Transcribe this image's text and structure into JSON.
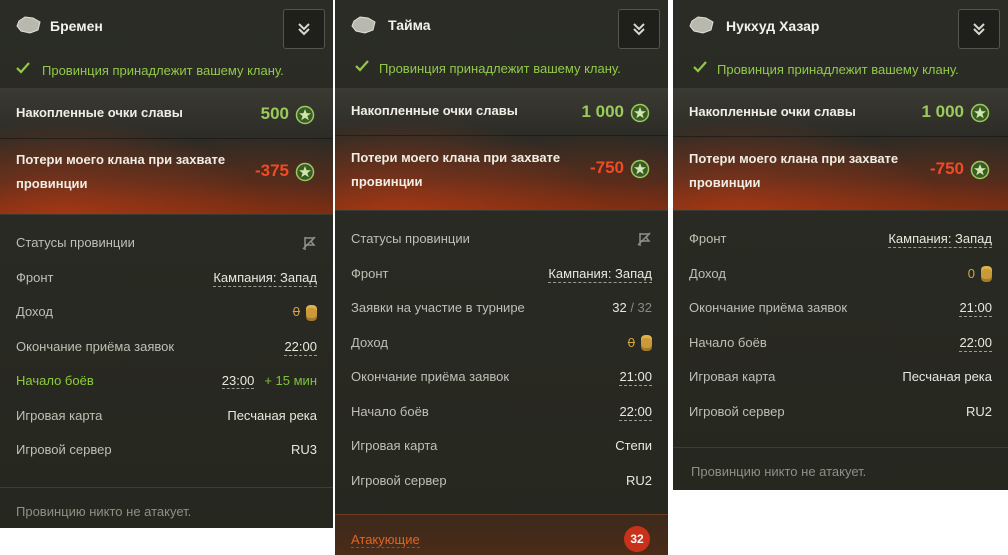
{
  "panels": [
    {
      "title": "Бремен",
      "owned": "Провинция принадлежит вашему клану.",
      "fame_label": "Накопленные очки славы",
      "fame_value": "500",
      "loss_label": "Потери моего клана при захвате провинции",
      "loss_value": "-375",
      "rows": {
        "status": "Статусы провинции",
        "front_k": "Фронт",
        "front_v": "Кампания: Запад",
        "income_k": "Доход",
        "income_v": "0",
        "end_k": "Окончание приёма заявок",
        "end_v": "22:00",
        "start_k": "Начало боёв",
        "start_v": "23:00",
        "start_plus": "+ 15 мин",
        "map_k": "Игровая карта",
        "map_v": "Песчаная река",
        "server_k": "Игровой сервер",
        "server_v": "RU3"
      },
      "footer": "Провинцию никто не атакует."
    },
    {
      "title": "Тайма",
      "owned": "Провинция принадлежит вашему клану.",
      "fame_label": "Накопленные очки славы",
      "fame_value": "1 000",
      "loss_label": "Потери моего клана при захвате провинции",
      "loss_value": "-750",
      "rows": {
        "status": "Статусы провинции",
        "front_k": "Фронт",
        "front_v": "Кампания: Запад",
        "apps_k": "Заявки на участие в турнире",
        "apps_v": "32",
        "apps_total": "/ 32",
        "income_k": "Доход",
        "income_v": "0",
        "end_k": "Окончание приёма заявок",
        "end_v": "21:00",
        "start_k": "Начало боёв",
        "start_v": "22:00",
        "map_k": "Игровая карта",
        "map_v": "Степи",
        "server_k": "Игровой сервер",
        "server_v": "RU2"
      },
      "attackers_label": "Атакующие",
      "attackers_count": "32"
    },
    {
      "title": "Нукхуд Хазар",
      "owned": "Провинция принадлежит вашему клану.",
      "fame_label": "Накопленные очки славы",
      "fame_value": "1 000",
      "loss_label": "Потери моего клана при захвате провинции",
      "loss_value": "-750",
      "rows": {
        "front_k": "Фронт",
        "front_v": "Кампания: Запад",
        "income_k": "Доход",
        "income_v": "0",
        "end_k": "Окончание приёма заявок",
        "end_v": "21:00",
        "start_k": "Начало боёв",
        "start_v": "22:00",
        "map_k": "Игровая карта",
        "map_v": "Песчаная река",
        "server_k": "Игровой сервер",
        "server_v": "RU2"
      },
      "footer": "Провинцию никто не атакует."
    }
  ],
  "icons": {
    "map": "province-map-icon",
    "toggle": "double-chevron-down-icon",
    "check": "check-icon",
    "fame": "fame-points-icon",
    "gold": "gold-coins-icon",
    "status": "flag-off-icon"
  },
  "colors": {
    "positive": "#9acb5c",
    "negative": "#f24a25",
    "gold": "#d5a541",
    "accent_green": "#8ccd3a",
    "attack": "#e06524"
  }
}
